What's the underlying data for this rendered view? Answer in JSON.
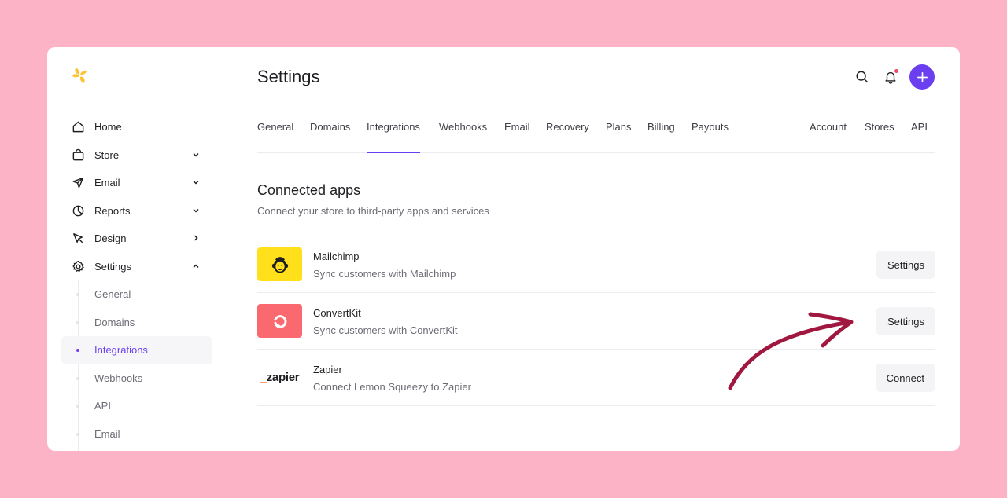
{
  "header": {
    "title": "Settings"
  },
  "sidebar": {
    "items": [
      {
        "label": "Home",
        "icon": "home-icon",
        "chevron": ""
      },
      {
        "label": "Store",
        "icon": "bag-icon",
        "chevron": "down"
      },
      {
        "label": "Email",
        "icon": "send-icon",
        "chevron": "down"
      },
      {
        "label": "Reports",
        "icon": "pie-chart-icon",
        "chevron": "down"
      },
      {
        "label": "Design",
        "icon": "cursor-icon",
        "chevron": "right"
      },
      {
        "label": "Settings",
        "icon": "gear-icon",
        "chevron": "up"
      }
    ],
    "sub_items": [
      {
        "label": "General",
        "active": false
      },
      {
        "label": "Domains",
        "active": false
      },
      {
        "label": "Integrations",
        "active": true
      },
      {
        "label": "Webhooks",
        "active": false
      },
      {
        "label": "API",
        "active": false
      },
      {
        "label": "Email",
        "active": false
      }
    ]
  },
  "tabs": {
    "main": [
      "General",
      "Domains",
      "Integrations",
      "Webhooks",
      "Email",
      "Recovery",
      "Plans",
      "Billing",
      "Payouts"
    ],
    "right": [
      "Account",
      "Stores",
      "API"
    ],
    "active": "Integrations"
  },
  "section": {
    "title": "Connected apps",
    "subtitle": "Connect your store to third-party apps and services"
  },
  "apps": [
    {
      "name": "Mailchimp",
      "description": "Sync customers with Mailchimp",
      "button": "Settings",
      "color": "#ffe01b"
    },
    {
      "name": "ConvertKit",
      "description": "Sync customers with ConvertKit",
      "button": "Settings",
      "color": "#fb6970"
    },
    {
      "name": "Zapier",
      "description": "Connect Lemon Squeezy to Zapier",
      "button": "Connect",
      "logo_text": "zapier"
    }
  ],
  "colors": {
    "background": "#fbb3c5",
    "accent": "#6b3ff0",
    "arrow": "#a01840",
    "notification": "#f0476a"
  }
}
